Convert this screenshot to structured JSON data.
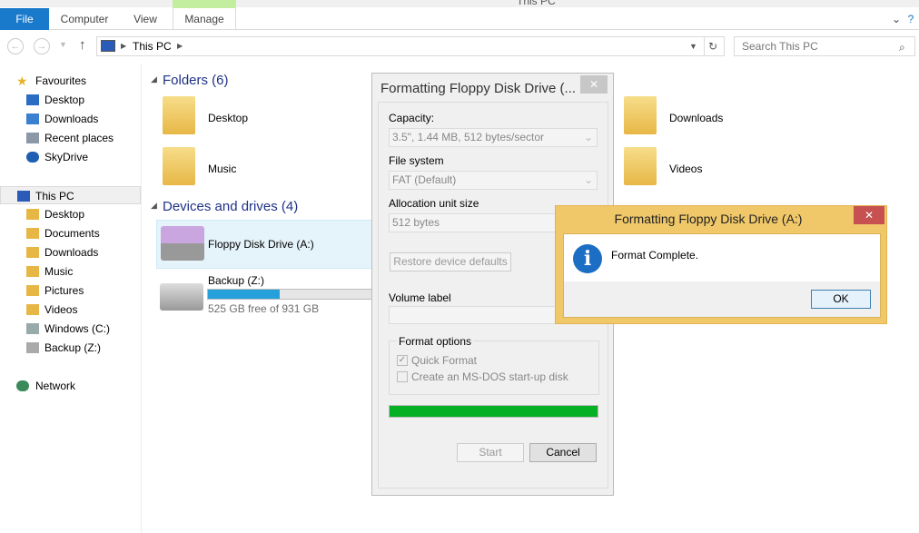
{
  "window": {
    "title": "This PC"
  },
  "ribbon": {
    "tabs": [
      "File",
      "Computer",
      "View",
      "Manage"
    ]
  },
  "address": {
    "path": "This PC",
    "search_placeholder": "Search This PC"
  },
  "sidebar": {
    "favourites": "Favourites",
    "fav_items": [
      "Desktop",
      "Downloads",
      "Recent places",
      "SkyDrive"
    ],
    "this_pc": "This PC",
    "pc_items": [
      "Desktop",
      "Documents",
      "Downloads",
      "Music",
      "Pictures",
      "Videos",
      "Windows (C:)",
      "Backup (Z:)"
    ],
    "network": "Network"
  },
  "main": {
    "folders_header": "Folders (6)",
    "folders": [
      "Desktop",
      "Music",
      "Downloads",
      "Videos"
    ],
    "devices_header": "Devices and drives (4)",
    "drives": [
      {
        "name": "Floppy Disk Drive (A:)"
      },
      {
        "name": "Backup (Z:)",
        "free": "525 GB free of 931 GB",
        "used_fraction": 0.44
      }
    ]
  },
  "format_dialog": {
    "title": "Formatting Floppy Disk Drive (...",
    "capacity_label": "Capacity:",
    "capacity": "3.5\", 1.44 MB, 512 bytes/sector",
    "fs_label": "File system",
    "fs": "FAT (Default)",
    "alloc_label": "Allocation unit size",
    "alloc": "512 bytes",
    "restore": "Restore device defaults",
    "volume_label": "Volume label",
    "volume_value": "",
    "options_label": "Format options",
    "quick": "Quick Format",
    "quick_checked": true,
    "msdos": "Create an MS-DOS start-up disk",
    "msdos_checked": false,
    "progress": 1.0,
    "start": "Start",
    "cancel": "Cancel"
  },
  "message_box": {
    "title": "Formatting Floppy Disk Drive (A:)",
    "text": "Format Complete.",
    "ok": "OK"
  },
  "colors": {
    "accent": "#1979ca",
    "progress": "#06b025",
    "msg_frame": "#f0c869"
  }
}
